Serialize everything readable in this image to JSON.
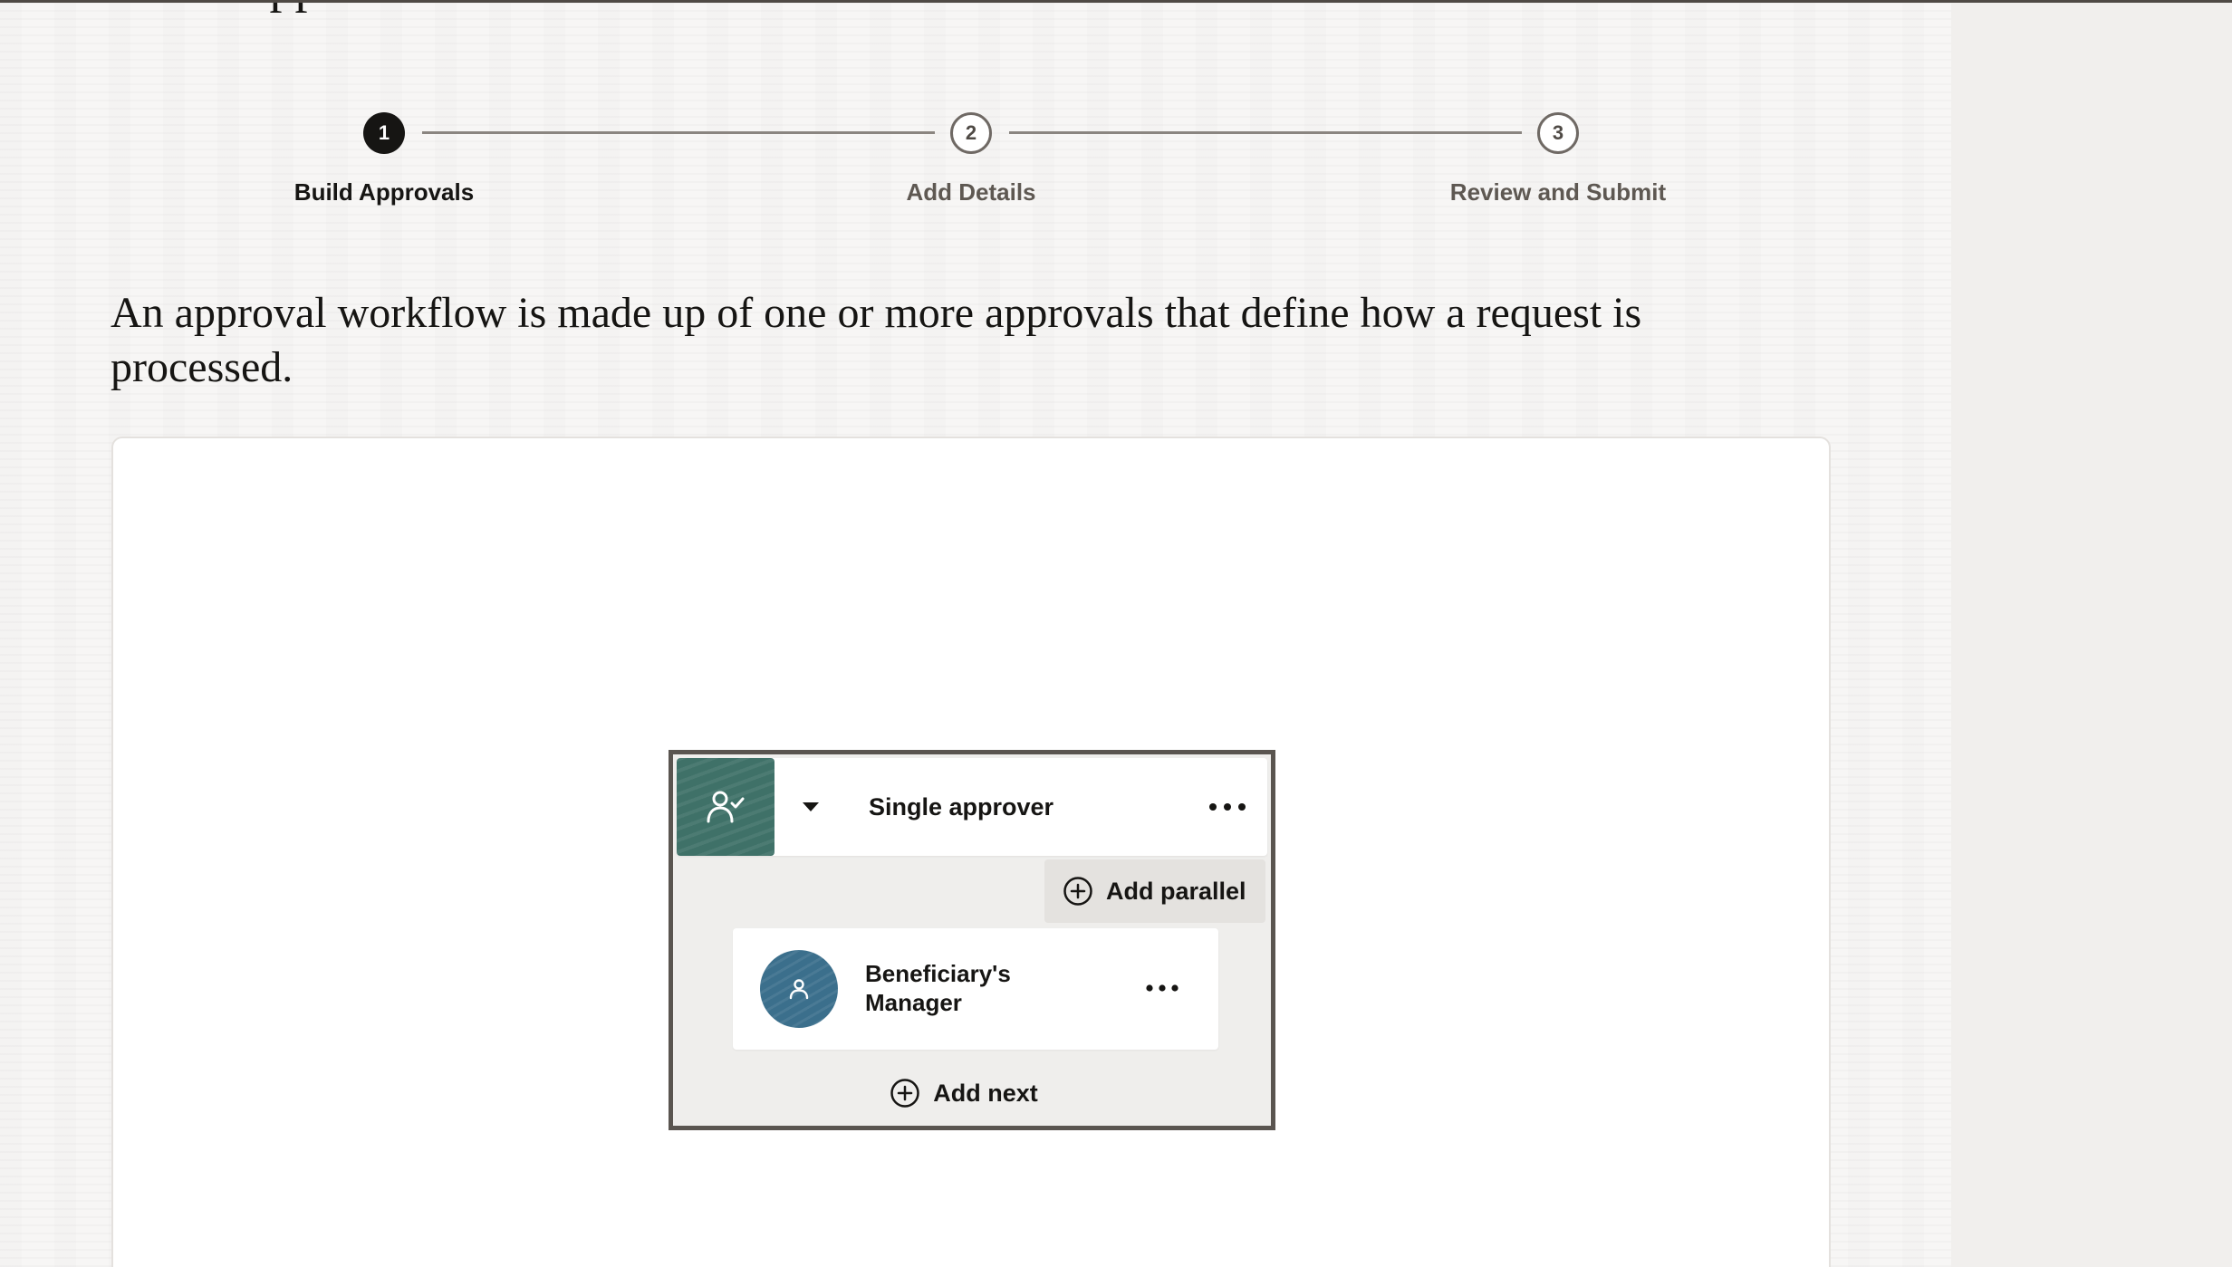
{
  "page": {
    "title_partial": "Create Approval Workflow",
    "intro": "An approval workflow is made up of one or more approvals that define how a request is processed."
  },
  "train": {
    "steps": [
      {
        "number": "1",
        "label": "Build Approvals",
        "state": "active"
      },
      {
        "number": "2",
        "label": "Add Details",
        "state": "inactive"
      },
      {
        "number": "3",
        "label": "Review and Submit",
        "state": "inactive"
      }
    ]
  },
  "canvas": {
    "group": {
      "title": "Single approver",
      "icon": "person-check-icon",
      "add_parallel_label": "Add parallel",
      "approver": {
        "name": "Beneficiary's Manager",
        "icon": "person-icon"
      },
      "add_next_label": "Add next"
    }
  },
  "colors": {
    "active_step": "#161513",
    "group_icon_bg": "#3f7168",
    "avatar_bg": "#3b6f8c",
    "group_border": "#5a5550"
  }
}
